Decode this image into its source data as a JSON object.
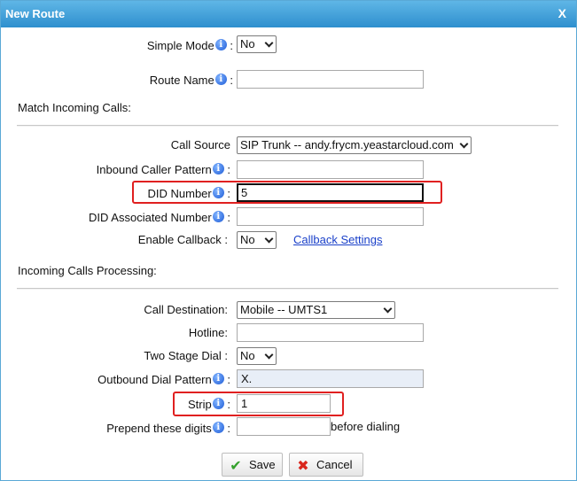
{
  "window": {
    "title": "New Route",
    "close_label": "X"
  },
  "form": {
    "simple_mode": {
      "label": "Simple Mode",
      "value": "No"
    },
    "route_name": {
      "label": "Route Name",
      "value": ""
    },
    "match_section": "Match Incoming Calls:",
    "call_source": {
      "label": "Call Source",
      "value": "SIP Trunk -- andy.frycm.yeastarcloud.com"
    },
    "inbound_caller_pattern": {
      "label": "Inbound Caller Pattern",
      "value": ""
    },
    "did_number": {
      "label": "DID Number",
      "value": "5"
    },
    "did_associated_number": {
      "label": "DID Associated Number",
      "value": ""
    },
    "enable_callback": {
      "label": "Enable Callback",
      "value": "No",
      "link": "Callback Settings"
    },
    "processing_section": "Incoming Calls Processing:",
    "call_destination": {
      "label": "Call Destination:",
      "value": "Mobile -- UMTS1"
    },
    "hotline": {
      "label": "Hotline:",
      "value": ""
    },
    "two_stage_dial": {
      "label": "Two Stage Dial",
      "value": "No"
    },
    "outbound_dial_pattern": {
      "label": "Outbound Dial Pattern",
      "value": "X."
    },
    "strip": {
      "label": "Strip",
      "value": "1"
    },
    "prepend_digits": {
      "label": "Prepend these digits",
      "value": "",
      "suffix": "before dialing"
    },
    "colon": ":",
    "info_glyph": "i"
  },
  "buttons": {
    "save": "Save",
    "cancel": "Cancel"
  },
  "icons": {
    "info": "info-icon",
    "save": "checkmark-icon",
    "cancel": "x-mark-icon",
    "close": "close-icon"
  },
  "colors": {
    "title_bar": "#2e8fce",
    "highlight": "#e02020",
    "link": "#1a40c9"
  }
}
